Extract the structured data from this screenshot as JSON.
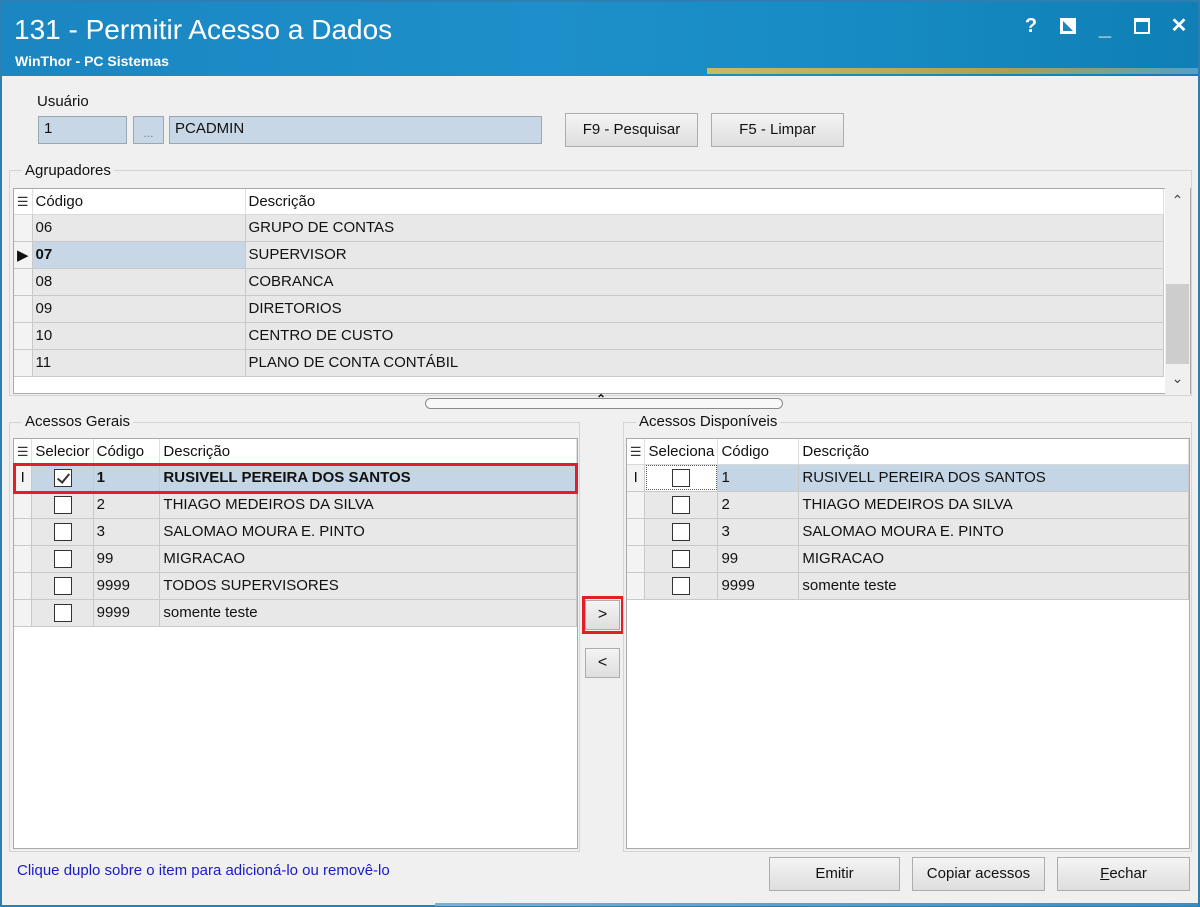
{
  "window": {
    "title": "131 - Permitir Acesso a Dados",
    "subtitle": "WinThor - PC Sistemas",
    "controls": [
      "?",
      "_",
      "✕"
    ]
  },
  "usuario": {
    "label": "Usuário",
    "code": "1",
    "dots": "...",
    "name": "PCADMIN",
    "search_button": "F9 - Pesquisar",
    "clear_button": "F5 - Limpar"
  },
  "agrupadores": {
    "label": "Agrupadores",
    "columns": [
      "Código",
      "Descrição"
    ],
    "rows": [
      {
        "code": "06",
        "desc": "GRUPO DE CONTAS"
      },
      {
        "code": "07",
        "desc": "SUPERVISOR"
      },
      {
        "code": "08",
        "desc": "COBRANCA"
      },
      {
        "code": "09",
        "desc": "DIRETORIOS"
      },
      {
        "code": "10",
        "desc": "CENTRO DE CUSTO"
      },
      {
        "code": "11",
        "desc": "PLANO DE CONTA CONTÁBIL"
      }
    ],
    "current_row": 1
  },
  "acessos_gerais": {
    "label": "Acessos Gerais",
    "columns": [
      "Selecior",
      "Código",
      "Descrição"
    ],
    "rows": [
      {
        "checked": true,
        "code": "1",
        "desc": "RUSIVELL PEREIRA DOS SANTOS"
      },
      {
        "checked": false,
        "code": "2",
        "desc": "THIAGO MEDEIROS DA SILVA"
      },
      {
        "checked": false,
        "code": "3",
        "desc": "SALOMAO MOURA E. PINTO"
      },
      {
        "checked": false,
        "code": "99",
        "desc": "MIGRACAO"
      },
      {
        "checked": false,
        "code": "9999",
        "desc": "TODOS SUPERVISORES"
      },
      {
        "checked": false,
        "code": "9999",
        "desc": "somente teste"
      }
    ]
  },
  "acessos_disponiveis": {
    "label": "Acessos Disponíveis",
    "columns": [
      "Seleciona",
      "Código",
      "Descrição"
    ],
    "rows": [
      {
        "checked": false,
        "code": "1",
        "desc": "RUSIVELL PEREIRA DOS SANTOS"
      },
      {
        "checked": false,
        "code": "2",
        "desc": "THIAGO MEDEIROS DA SILVA"
      },
      {
        "checked": false,
        "code": "3",
        "desc": "SALOMAO MOURA E. PINTO"
      },
      {
        "checked": false,
        "code": "99",
        "desc": "MIGRACAO"
      },
      {
        "checked": false,
        "code": "9999",
        "desc": "somente teste"
      }
    ]
  },
  "transfer": {
    "add": ">",
    "remove": "<"
  },
  "footer": {
    "hint": "Clique duplo sobre o item para adicioná-lo ou removê-lo",
    "emitir": "Emitir",
    "copiar": "Copiar acessos",
    "fechar_first": "F",
    "fechar_rest": "echar"
  },
  "colors": {
    "titlebar": "#1a86c2",
    "highlight_row": "#c4d5e6",
    "callout_red": "#e41e26",
    "hint_text": "#1a1acc"
  }
}
